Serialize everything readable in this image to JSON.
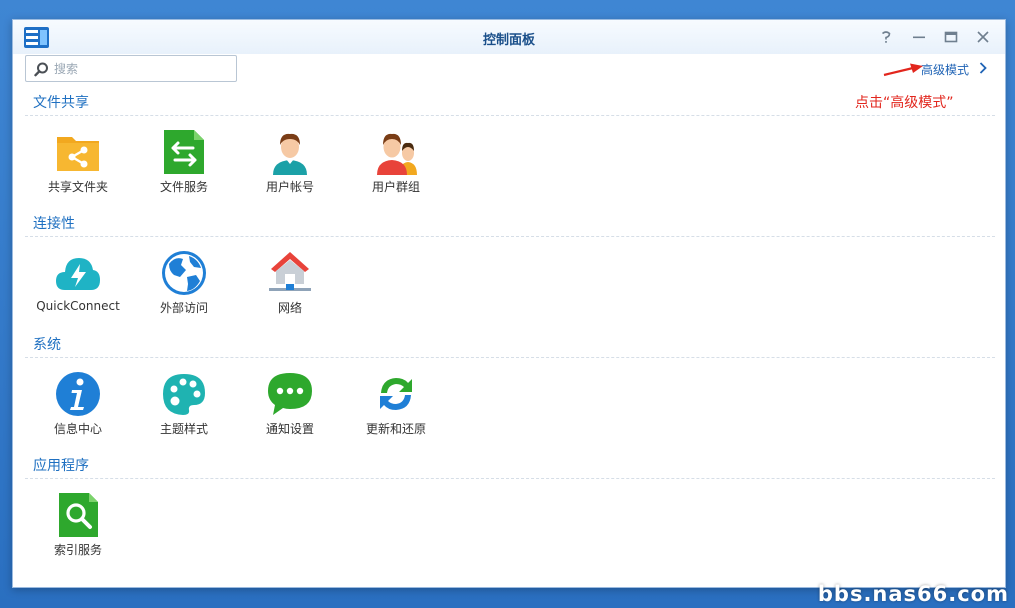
{
  "window": {
    "title": "控制面板"
  },
  "toolbar": {
    "search_placeholder": "搜索",
    "advanced_mode_label": "高级模式"
  },
  "annotation": {
    "text": "点击“高级模式”",
    "color": "#e2261d"
  },
  "sections": [
    {
      "title": "文件共享",
      "items": [
        {
          "label": "共享文件夹",
          "icon": "shared-folder-icon"
        },
        {
          "label": "文件服务",
          "icon": "file-services-icon"
        },
        {
          "label": "用户帐号",
          "icon": "user-icon"
        },
        {
          "label": "用户群组",
          "icon": "group-icon"
        }
      ]
    },
    {
      "title": "连接性",
      "items": [
        {
          "label": "QuickConnect",
          "icon": "quickconnect-cloud-icon"
        },
        {
          "label": "外部访问",
          "icon": "globe-icon"
        },
        {
          "label": "网络",
          "icon": "network-house-icon"
        }
      ]
    },
    {
      "title": "系统",
      "items": [
        {
          "label": "信息中心",
          "icon": "info-icon"
        },
        {
          "label": "主题样式",
          "icon": "palette-icon"
        },
        {
          "label": "通知设置",
          "icon": "chat-bubble-icon"
        },
        {
          "label": "更新和还原",
          "icon": "refresh-icon"
        }
      ]
    },
    {
      "title": "应用程序",
      "items": [
        {
          "label": "索引服务",
          "icon": "search-document-icon"
        }
      ]
    }
  ],
  "watermark": "bbs.nas66.com",
  "colors": {
    "desktop": "#2a6fc0",
    "section_title": "#1f70c1",
    "link": "#1f63b5"
  }
}
